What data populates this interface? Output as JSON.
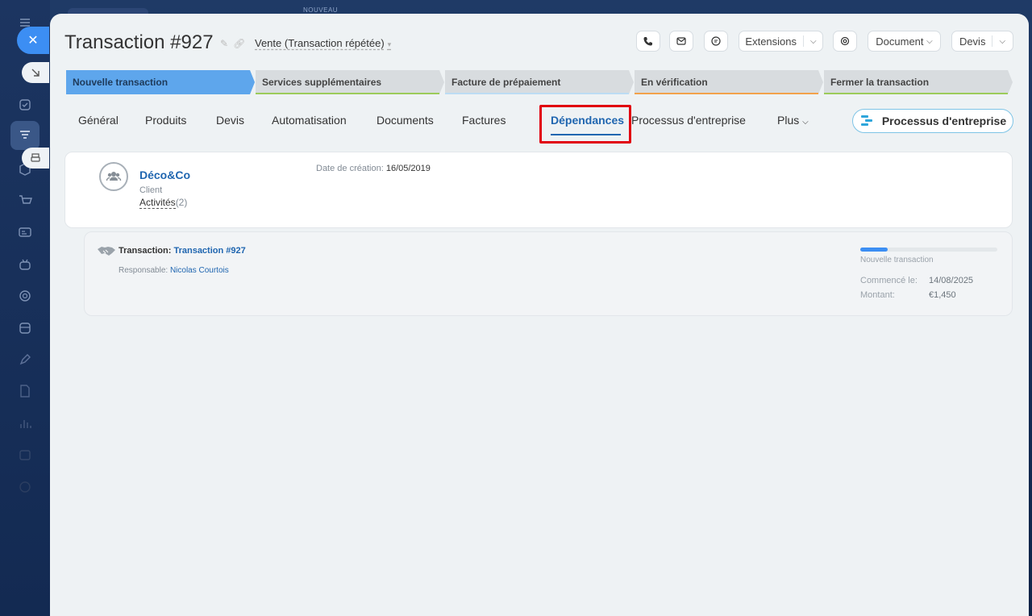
{
  "topbar": {
    "nouveau": "NOUVEAU"
  },
  "header": {
    "title": "Transaction #927",
    "pipeline": "Vente (Transaction répétée)",
    "extensions_label": "Extensions",
    "document_label": "Document",
    "devis_label": "Devis"
  },
  "stages": [
    {
      "label": "Nouvelle transaction",
      "bg": "#5ea6ec",
      "fg": "#1e3a5a",
      "bar": "#5ea6ec"
    },
    {
      "label": "Services supplémentaires",
      "bg": "#d8dcdf",
      "fg": "#444",
      "bar": "#9ccb5a"
    },
    {
      "label": "Facture de prépaiement",
      "bg": "#d8dcdf",
      "fg": "#444",
      "bar": "#bcdcf3"
    },
    {
      "label": "En vérification",
      "bg": "#d8dcdf",
      "fg": "#444",
      "bar": "#f2a24b"
    },
    {
      "label": "Fermer la transaction",
      "bg": "#d8dcdf",
      "fg": "#444",
      "bar": "#9ccb5a"
    }
  ],
  "tabs": {
    "general": "Général",
    "produits": "Produits",
    "devis": "Devis",
    "automatisation": "Automatisation",
    "documents": "Documents",
    "factures": "Factures",
    "dependances": "Dépendances",
    "processus": "Processus d'entreprise",
    "plus": "Plus"
  },
  "bp_button": "Processus d'entreprise",
  "client_card": {
    "company": "Déco&Co",
    "type": "Client",
    "activities_label": "Activités",
    "activities_count": "(2)",
    "created_label": "Date de création:",
    "created_value": "16/05/2019"
  },
  "transaction_card": {
    "label": "Transaction:",
    "link": "Transaction #927",
    "resp_label": "Responsable:",
    "resp_name": "Nicolas Courtois",
    "progress": 0.2,
    "stage": "Nouvelle transaction",
    "started_label": "Commencé le:",
    "started_value": "14/08/2025",
    "amount_label": "Montant:",
    "amount_value": "€1,450"
  }
}
